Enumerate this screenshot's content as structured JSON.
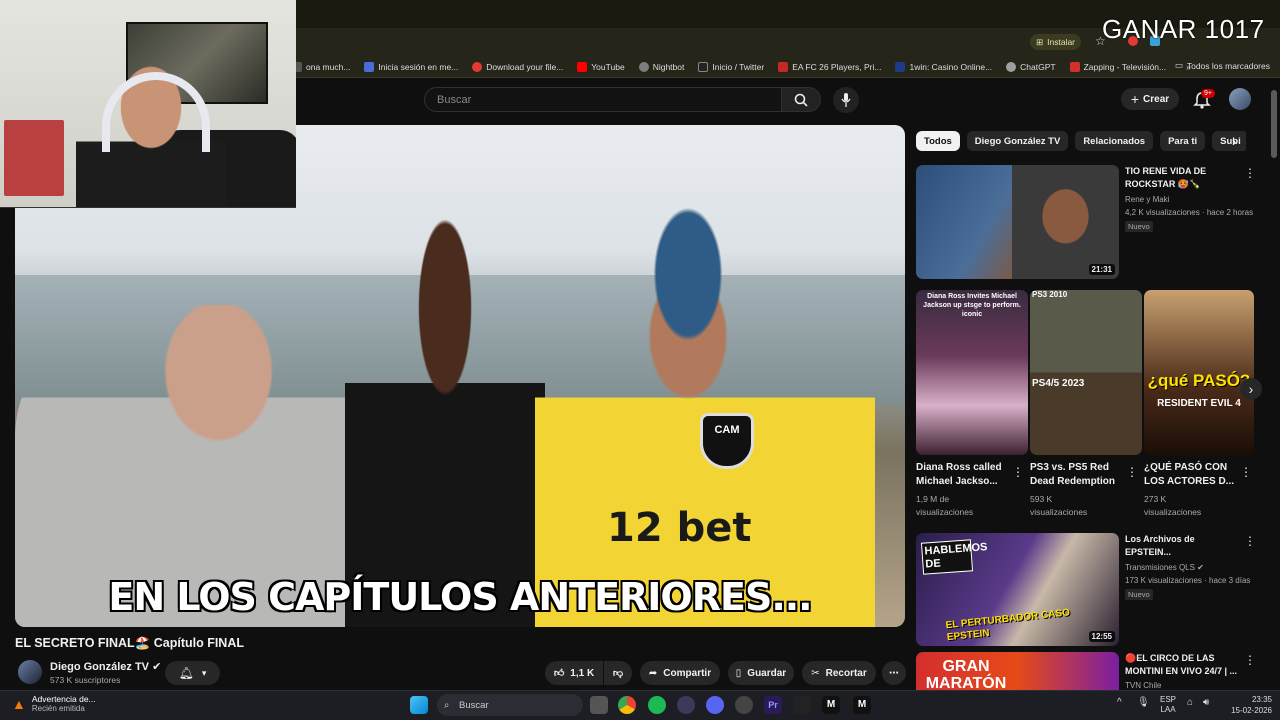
{
  "browser": {
    "install_label": "Instalar",
    "bookmarks": [
      {
        "label": "ona much...",
        "color": "#555"
      },
      {
        "label": "Inicia sesión en me...",
        "color": "#4a6bd8"
      },
      {
        "label": "Download your file...",
        "color": "#e53935"
      },
      {
        "label": "YouTube",
        "color": "#ff0000"
      },
      {
        "label": "Nightbot",
        "color": "#7d7d7d"
      },
      {
        "label": "Inicio / Twitter",
        "color": "#222"
      },
      {
        "label": "EA FC 26 Players, Pri...",
        "color": "#c62828"
      },
      {
        "label": "1win: Casino Online...",
        "color": "#1e3a8a"
      },
      {
        "label": "ChatGPT",
        "color": "#9e9e9e"
      },
      {
        "label": "Zapping - Televisión...",
        "color": "#d32f2f"
      }
    ],
    "all_bookmarks_label": "Todos los marcadores"
  },
  "overlay": {
    "text": "GANAR 1017"
  },
  "header": {
    "search_placeholder": "Buscar",
    "create_label": "Crear",
    "notifications_badge": "9+"
  },
  "video": {
    "subtitle": "EN LOS CAPÍTULOS ANTERIORES...",
    "sponsor_text": "12 bet",
    "badge_text": "CAM",
    "title": "EL SECRETO FINAL🏖️ Capítulo FINAL",
    "channel_name": "Diego González TV ✔",
    "subscribers": "573 K suscriptores",
    "likes": "1,1 K",
    "share_label": "Compartir",
    "save_label": "Guardar",
    "clip_label": "Recortar"
  },
  "chips": [
    "Todos",
    "Diego González TV",
    "Relacionados",
    "Para ti",
    "Subi"
  ],
  "sidebar": {
    "video1": {
      "title_line1": "TIO RENE VIDA DE",
      "title_line2": "ROCKSTAR 🥵🍾",
      "channel": "Rene y Maki",
      "meta": "4,2 K visualizaciones · hace 2 horas",
      "badge": "Nuevo",
      "duration": "21:31"
    },
    "shorts": [
      {
        "title": "Diana Ross called Michael Jackso...",
        "views_line1": "1,9 M de",
        "views_line2": "visualizaciones",
        "thumb_text": "Diana Ross Invites Michael Jackson up stsge to perform. iconic"
      },
      {
        "title": "PS3 vs. PS5 Red Dead Redemption",
        "views_line1": "593 K",
        "views_line2": "visualizaciones",
        "thumb_text": "PS3 2010",
        "thumb_text2": "PS4/5 2023"
      },
      {
        "title": "¿QUÉ PASÓ CON LOS ACTORES D...",
        "views_line1": "273 K",
        "views_line2": "visualizaciones",
        "thumb_text": "¿qué PASÓ?",
        "thumb_text2": "RESIDENT EVIL 4"
      }
    ],
    "video2": {
      "title_line1": "Los Archivos de",
      "title_line2": "EPSTEIN...",
      "channel": "Transmisiones QLS ✔",
      "meta": "173 K visualizaciones · hace 3 días",
      "badge": "Nuevo",
      "duration": "12:55",
      "thumb_top": "HABLEMOS DE",
      "thumb_bottom": "EL PERTURBADOR CASO EPSTEIN"
    },
    "video3": {
      "title_line1": "🔴EL CIRCO DE LAS",
      "title_line2": "MONTINI EN VIVO 24/7 | ...",
      "channel": "TVN Chile",
      "thumb_text": "GRAN MARATÓN"
    }
  },
  "taskbar": {
    "warning_title": "Advertencia de...",
    "warning_sub": "Recién emitida",
    "search_label": "Buscar",
    "lang_line1": "ESP",
    "lang_line2": "LAA",
    "time": "23:35",
    "date": "15-02-2026"
  }
}
